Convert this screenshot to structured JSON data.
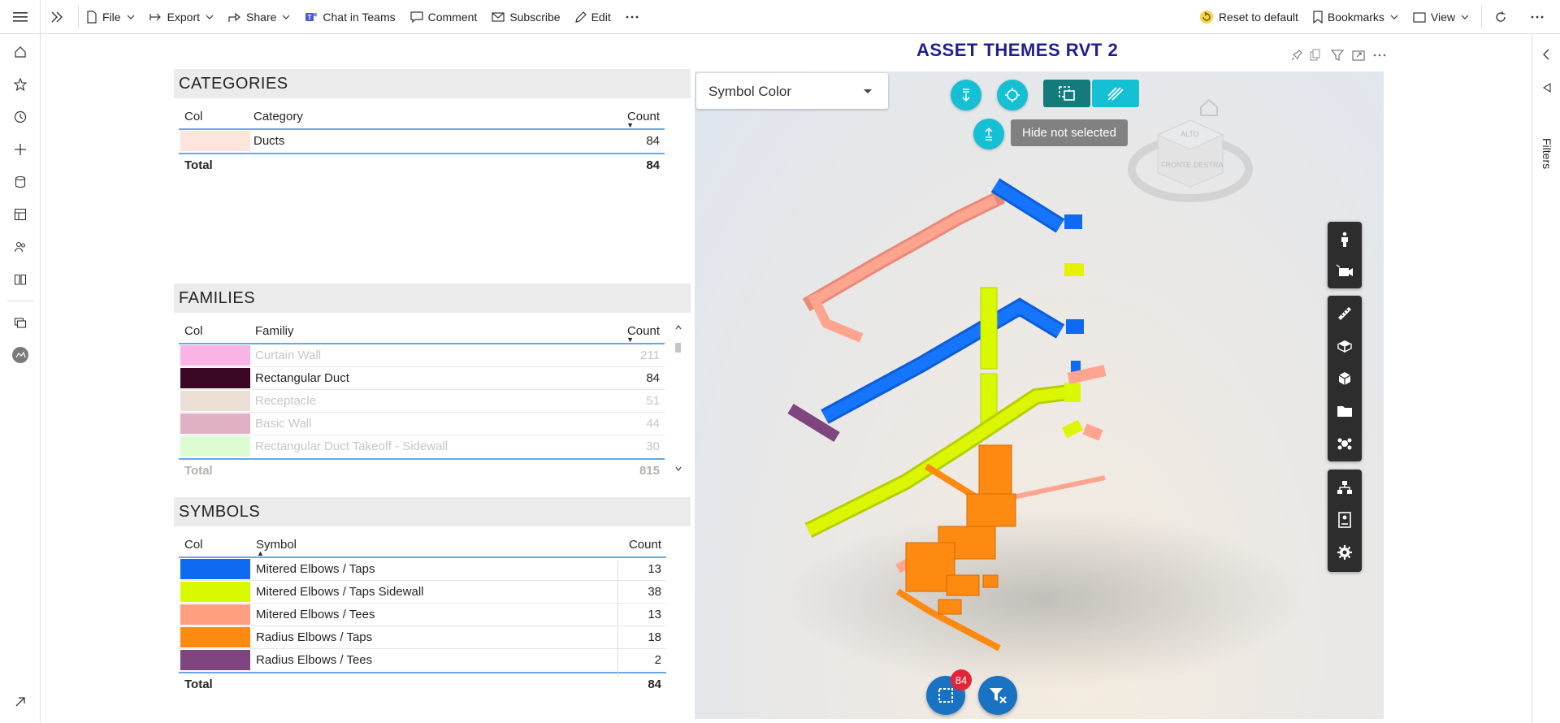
{
  "toolbar": {
    "file": "File",
    "export": "Export",
    "share": "Share",
    "chat_in_teams": "Chat in Teams",
    "comment": "Comment",
    "subscribe": "Subscribe",
    "edit": "Edit",
    "reset_to_default": "Reset to default",
    "bookmarks": "Bookmarks",
    "view": "View"
  },
  "filters_pane": {
    "label": "Filters"
  },
  "report": {
    "title": "ASSET THEMES RVT 2"
  },
  "categories": {
    "title": "CATEGORIES",
    "headers": {
      "col": "Col",
      "name": "Category",
      "count": "Count"
    },
    "rows": [
      {
        "name": "Ducts",
        "count": "84",
        "color": "#fde4dc"
      }
    ],
    "total_label": "Total",
    "total": "84"
  },
  "families": {
    "title": "FAMILIES",
    "headers": {
      "col": "Col",
      "name": "Familiy",
      "count": "Count"
    },
    "rows": [
      {
        "name": "Curtain Wall",
        "count": "211",
        "color": "#f9b3e4",
        "dimmed": true
      },
      {
        "name": "Rectangular Duct",
        "count": "84",
        "color": "#3b0524",
        "dimmed": false
      },
      {
        "name": "Receptacle",
        "count": "51",
        "color": "#ece0d6",
        "dimmed": true
      },
      {
        "name": "Basic Wall",
        "count": "44",
        "color": "#e0b1c5",
        "dimmed": true
      },
      {
        "name": "Rectangular Duct Takeoff - Sidewall",
        "count": "30",
        "color": "#defcd4",
        "dimmed": true
      }
    ],
    "total_label": "Total",
    "total": "815"
  },
  "symbols": {
    "title": "SYMBOLS",
    "headers": {
      "col": "Col",
      "name": "Symbol",
      "count": "Count"
    },
    "rows": [
      {
        "name": "Mitered Elbows / Taps",
        "count": "13",
        "color": "#0f6af2"
      },
      {
        "name": "Mitered Elbows / Taps Sidewall",
        "count": "38",
        "color": "#d9f900"
      },
      {
        "name": "Mitered Elbows / Tees",
        "count": "13",
        "color": "#ff9e80"
      },
      {
        "name": "Radius Elbows / Taps",
        "count": "18",
        "color": "#ff8a12"
      },
      {
        "name": "Radius Elbows / Tees",
        "count": "2",
        "color": "#7e457f"
      }
    ],
    "total_label": "Total",
    "total": "84"
  },
  "viewer": {
    "dropdown_value": "Symbol Color",
    "tooltip": "Hide not selected",
    "viewcube_labels": [
      "ALTO",
      "FRONTE",
      "DESTRA"
    ],
    "selection_badge": "84",
    "colors": {
      "accent": "#15bfd4",
      "dark_teal": "#137b7b",
      "primary": "#1a72c2",
      "badge": "#e32636"
    }
  }
}
